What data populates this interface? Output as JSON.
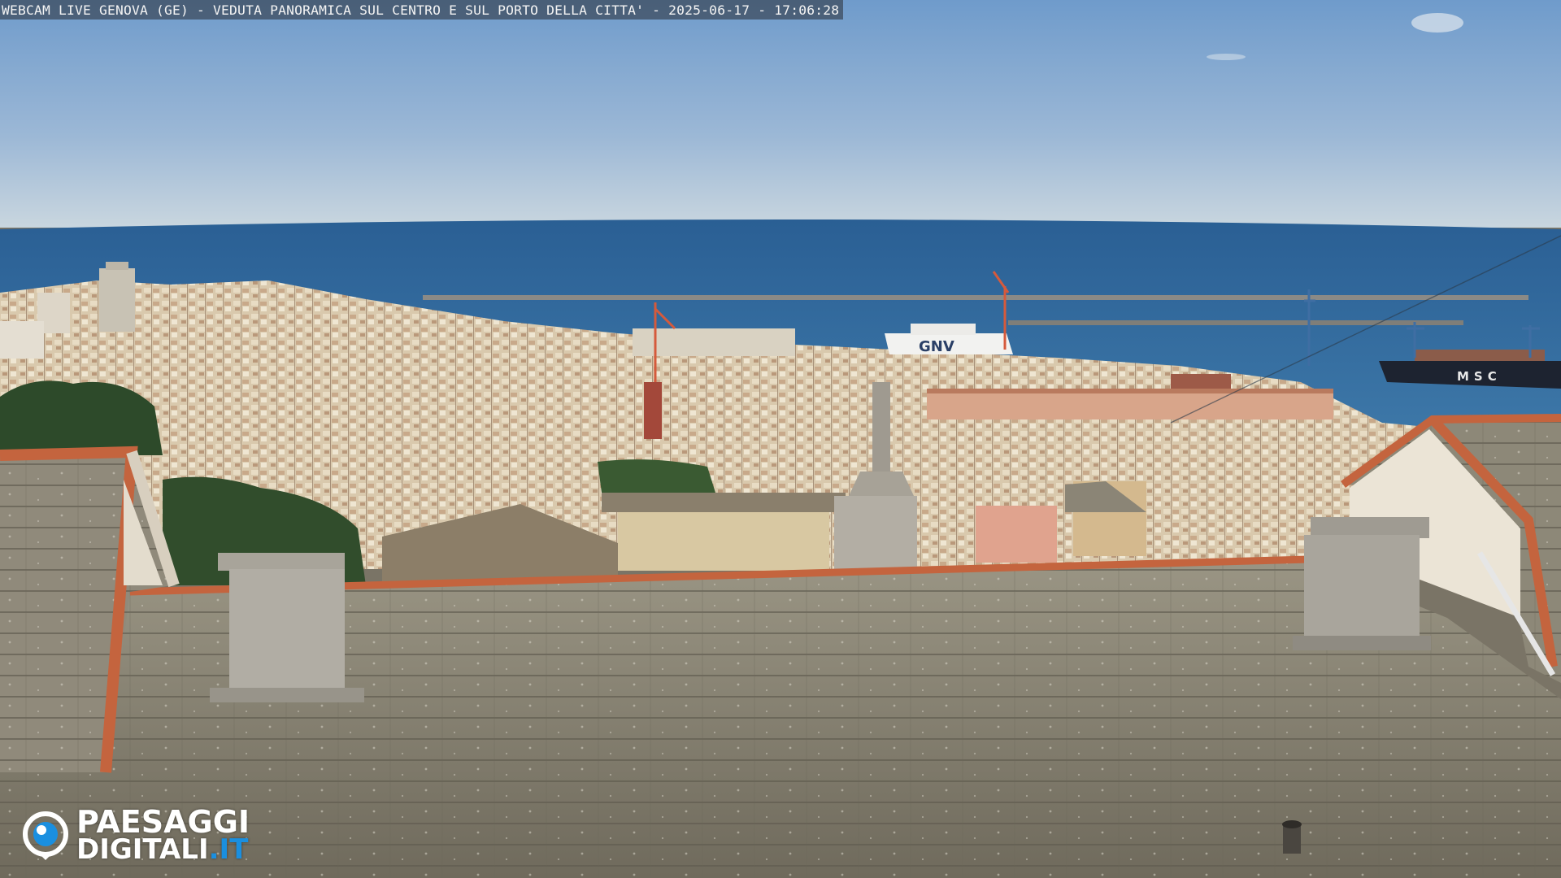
{
  "caption": {
    "text": "WEBCAM LIVE GENOVA (GE) - VEDUTA PANORAMICA SUL CENTRO E SUL PORTO DELLA CITTA' - 2025-06-17 - 17:06:28"
  },
  "logo": {
    "line1": "PAESAGGI",
    "line2_main": "DIGITALI",
    "line2_tld": ".IT",
    "icon": "webcam-lens-icon"
  },
  "ship_marking": "GNV",
  "ship_marking_2": "MSC",
  "colors": {
    "sky_top": "#6f9bc9",
    "sky_horizon": "#c6d4de",
    "sea": "#2f6aa0",
    "roof_tiles": "#8a8576",
    "terracotta": "#c4643e",
    "logo_tld": "#1a8fe0"
  }
}
